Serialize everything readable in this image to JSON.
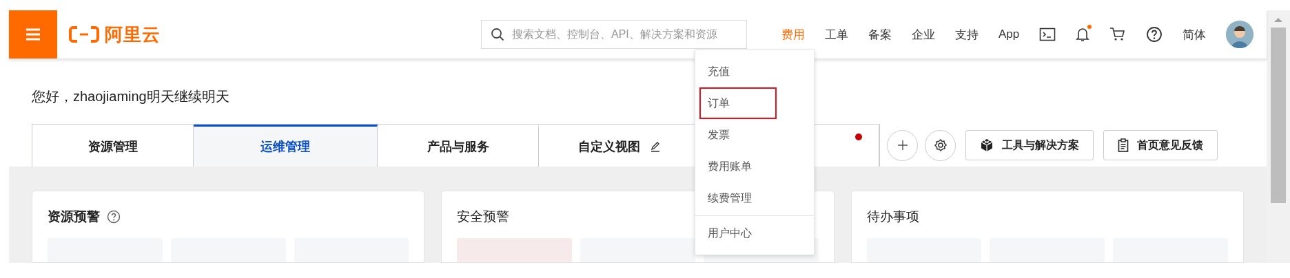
{
  "header": {
    "logo": "阿里云",
    "search": {
      "placeholder": "搜索文档、控制台、API、解决方案和资源"
    },
    "nav": [
      {
        "label": "费用",
        "selected": true
      },
      {
        "label": "工单",
        "selected": false
      },
      {
        "label": "备案",
        "selected": false
      },
      {
        "label": "企业",
        "selected": false
      },
      {
        "label": "支持",
        "selected": false
      },
      {
        "label": "App",
        "selected": false
      }
    ],
    "notification_badge": true,
    "language": "简体"
  },
  "greeting": "您好，zhaojiaming明天继续明天",
  "tabs": [
    {
      "label": "资源管理",
      "selected": false,
      "editable": false,
      "dot": false
    },
    {
      "label": "运维管理",
      "selected": true,
      "editable": false,
      "dot": false
    },
    {
      "label": "产品与服务",
      "selected": false,
      "editable": false,
      "dot": false
    },
    {
      "label": "自定义视图",
      "selected": false,
      "editable": true,
      "dot": false
    },
    {
      "selected": false,
      "editable": false,
      "dot": true
    }
  ],
  "toolbar_buttons": [
    "工具与解决方案",
    "首页意见反馈"
  ],
  "cards": [
    {
      "title": "资源预警",
      "help": true,
      "tiles": [
        {
          "alert": false
        },
        {
          "alert": false
        },
        {
          "alert": false
        }
      ]
    },
    {
      "title": "安全预警",
      "help": false,
      "tiles": [
        {
          "alert": true
        },
        {
          "alert": false
        },
        {
          "alert": false
        }
      ]
    },
    {
      "title": "待办事项",
      "help": false,
      "tiles": [
        {
          "alert": false
        },
        {
          "alert": false
        },
        {
          "alert": false
        }
      ]
    }
  ],
  "dropdown": [
    {
      "label": "充值",
      "highlighted": false,
      "divider_before": false
    },
    {
      "label": "订单",
      "highlighted": true,
      "divider_before": false
    },
    {
      "label": "发票",
      "highlighted": false,
      "divider_before": false
    },
    {
      "label": "费用账单",
      "highlighted": false,
      "divider_before": false
    },
    {
      "label": "续费管理",
      "highlighted": false,
      "divider_before": false
    },
    {
      "label": "用户中心",
      "highlighted": false,
      "divider_before": true
    }
  ]
}
